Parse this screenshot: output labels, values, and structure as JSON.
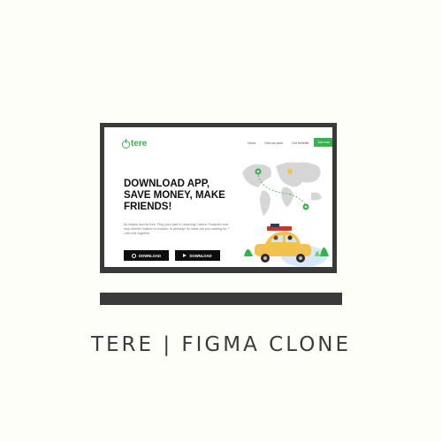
{
  "site": {
    "logo": "tere",
    "nav": [
      "Home",
      "How we work",
      "Our benefits"
    ],
    "nav_button": "Join now",
    "headline": "DOWNLOAD APP, SAVE MONEY, MAKE FRIENDS!",
    "body": "Its simple and its free. Play your part in reducing Carbon Footprint and help Mother Nature to sustain. Is Already! So what are you waiting for ? Lets ride together",
    "download_ios": "DOWNLOAD",
    "download_android": "DOWNLOAD"
  },
  "caption": "TERE | FIGMA CLONE",
  "colors": {
    "accent": "#38b24a",
    "frame": "#3a3a3a",
    "car": "#f2c14e"
  },
  "icons": [
    "power-logo-icon",
    "apple-icon",
    "play-store-icon",
    "location-pin-icon"
  ]
}
